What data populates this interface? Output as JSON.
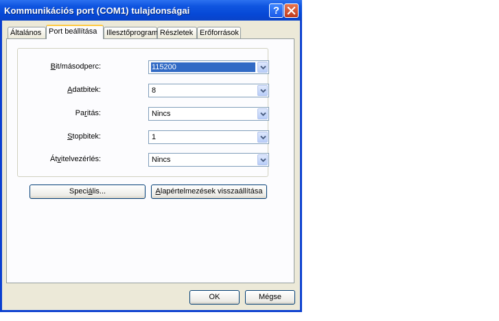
{
  "window": {
    "title": "Kommunikációs port (COM1) tulajdonságai",
    "help_glyph": "?",
    "close_glyph": "✕"
  },
  "tabs": [
    {
      "label": "Általános",
      "active": false
    },
    {
      "label": "Port beállítása",
      "active": true
    },
    {
      "label": "Illesztőprogram",
      "active": false
    },
    {
      "label": "Részletek",
      "active": false
    },
    {
      "label": "Erőforrások",
      "active": false
    }
  ],
  "settings": {
    "bits_per_second": {
      "label_pre": "",
      "label_key": "B",
      "label_post": "it/másodperc:",
      "value": "115200"
    },
    "data_bits": {
      "label_pre": "",
      "label_key": "A",
      "label_post": "datbitek:",
      "value": "8"
    },
    "parity": {
      "label_pre": "Pa",
      "label_key": "r",
      "label_post": "itás:",
      "value": "Nincs"
    },
    "stop_bits": {
      "label_pre": "",
      "label_key": "S",
      "label_post": "topbitek:",
      "value": "1"
    },
    "flow_control": {
      "label_pre": "Át",
      "label_key": "v",
      "label_post": "itelvezérlés:",
      "value": "Nincs"
    }
  },
  "buttons": {
    "advanced": {
      "pre": "Speci",
      "key": "á",
      "post": "lis..."
    },
    "restore_defaults": {
      "pre": "",
      "key": "A",
      "post": "lapértelmezések visszaállítása"
    },
    "ok": "OK",
    "cancel": "Mégse"
  },
  "colors": {
    "title_bar": "#0a4fd8",
    "selection": "#316ac5",
    "active_tab_accent": "#ffc83c",
    "dialog_bg": "#ece9d8"
  },
  "icons": {
    "dropdown": "chevron-down-icon",
    "help": "help-icon",
    "close": "close-icon"
  }
}
